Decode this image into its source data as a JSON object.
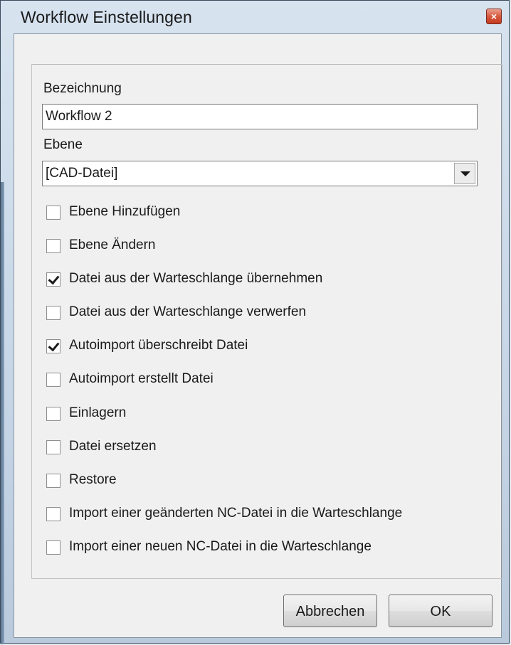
{
  "window": {
    "title": "Workflow Einstellungen",
    "close_glyph": "×",
    "close_icon": "close-icon"
  },
  "form": {
    "name_label": "Bezeichnung",
    "name_value": "Workflow 2",
    "level_label": "Ebene",
    "level_value": "[CAD-Datei]"
  },
  "checkboxes": [
    {
      "label": "Ebene Hinzufügen",
      "checked": false
    },
    {
      "label": "Ebene Ändern",
      "checked": false
    },
    {
      "label": "Datei aus der Warteschlange übernehmen",
      "checked": true
    },
    {
      "label": "Datei aus der Warteschlange verwerfen",
      "checked": false
    },
    {
      "label": "Autoimport überschreibt Datei",
      "checked": true
    },
    {
      "label": "Autoimport erstellt Datei",
      "checked": false
    },
    {
      "label": "Einlagern",
      "checked": false
    },
    {
      "label": "Datei ersetzen",
      "checked": false
    },
    {
      "label": "Restore",
      "checked": false
    },
    {
      "label": "Import einer geänderten NC-Datei in die Warteschlange",
      "checked": false
    },
    {
      "label": "Import einer neuen NC-Datei in die Warteschlange",
      "checked": false
    }
  ],
  "buttons": {
    "cancel": "Abbrechen",
    "ok": "OK"
  }
}
